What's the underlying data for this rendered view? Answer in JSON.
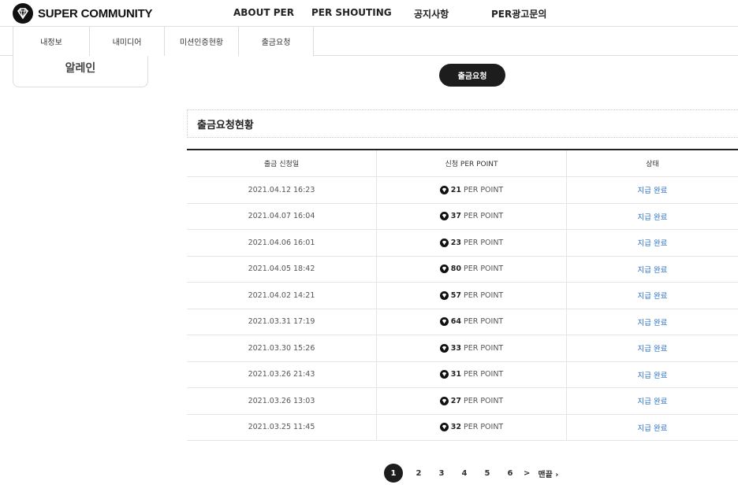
{
  "header": {
    "logo_text": "SUPER COMMUNITY",
    "nav": [
      "ABOUT PER",
      "PER SHOUTING",
      "공지사항",
      "PER광고문의"
    ]
  },
  "tabs": [
    {
      "label": "내정보",
      "active": false
    },
    {
      "label": "내미디어",
      "active": false
    },
    {
      "label": "미션인증현황",
      "active": false
    },
    {
      "label": "출금요청",
      "active": true
    }
  ],
  "sidebar": {
    "user_name": "알레인"
  },
  "main": {
    "request_button": "출금요청",
    "section_title": "출금요청현황",
    "columns": [
      "출금 신청일",
      "신청 PER POINT",
      "상태"
    ],
    "rows": [
      {
        "date": "2021.04.12 16:23",
        "points": "21",
        "unit": "PER POINT",
        "status": "지급 완료"
      },
      {
        "date": "2021.04.07 16:04",
        "points": "37",
        "unit": "PER POINT",
        "status": "지급 완료"
      },
      {
        "date": "2021.04.06 16:01",
        "points": "23",
        "unit": "PER POINT",
        "status": "지급 완료"
      },
      {
        "date": "2021.04.05 18:42",
        "points": "80",
        "unit": "PER POINT",
        "status": "지급 완료"
      },
      {
        "date": "2021.04.02 14:21",
        "points": "57",
        "unit": "PER POINT",
        "status": "지급 완료"
      },
      {
        "date": "2021.03.31 17:19",
        "points": "64",
        "unit": "PER POINT",
        "status": "지급 완료"
      },
      {
        "date": "2021.03.30 15:26",
        "points": "33",
        "unit": "PER POINT",
        "status": "지급 완료"
      },
      {
        "date": "2021.03.26 21:43",
        "points": "31",
        "unit": "PER POINT",
        "status": "지급 완료"
      },
      {
        "date": "2021.03.26 13:03",
        "points": "27",
        "unit": "PER POINT",
        "status": "지급 완료"
      },
      {
        "date": "2021.03.25 11:45",
        "points": "32",
        "unit": "PER POINT",
        "status": "지급 완료"
      }
    ]
  },
  "pagination": {
    "current": "1",
    "pages": [
      "2",
      "3",
      "4",
      "5",
      "6"
    ],
    "next": ">",
    "last": "맨끝 ›"
  },
  "colors": {
    "accent": "#1d1d1d",
    "status": "#2a6fc9",
    "border": "#dddddd"
  },
  "icons": {
    "logo": "diamond-logo-icon",
    "point": "diamond-point-icon"
  }
}
